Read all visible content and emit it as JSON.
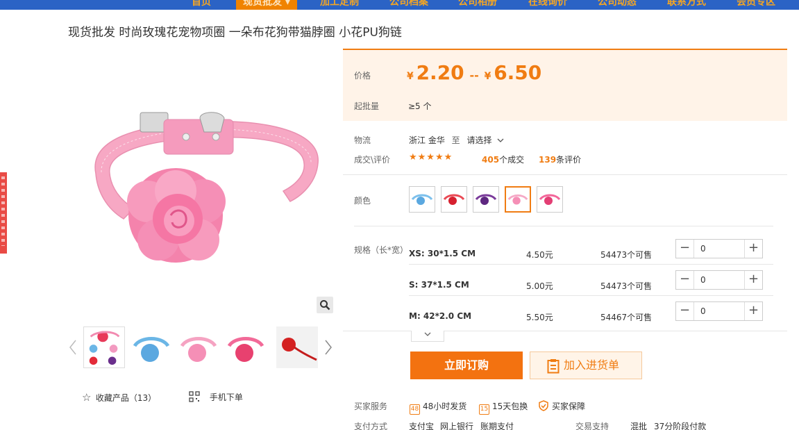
{
  "nav": {
    "items": [
      "首页",
      "现货批发 ▾",
      "加工定制",
      "公司档案",
      "公司相册",
      "在线询价",
      "公司动态",
      "联系方式",
      "会员专区"
    ],
    "active_index": 1
  },
  "product": {
    "title": "现货批发 时尚玫瑰花宠物项圈 一朵布花狗带猫脖圈 小花PU狗链"
  },
  "price": {
    "label": "价格",
    "currency": "¥",
    "min": "2.20",
    "separator": "--",
    "max": "6.50",
    "moq_label": "起批量",
    "moq_value": "≥5 个"
  },
  "logistics": {
    "label": "物流",
    "origin": "浙江 金华",
    "to": "至",
    "destination": "请选择",
    "chevron": "chevron-down-icon"
  },
  "rating": {
    "label": "成交\\评价",
    "stars": "★★★★★",
    "deals_count": "405",
    "deals_suffix": "个成交",
    "reviews_count": "139",
    "reviews_suffix": "条评价"
  },
  "color": {
    "label": "颜色",
    "swatches": [
      "blue",
      "red",
      "purple",
      "pink",
      "rose"
    ],
    "selected_index": 3
  },
  "spec": {
    "label": "规格（长*宽）",
    "rows": [
      {
        "name": "XS: 30*1.5 CM",
        "price": "4.50元",
        "available": "54473个可售",
        "qty": "0"
      },
      {
        "name": "S: 37*1.5 CM",
        "price": "5.00元",
        "available": "54473个可售",
        "qty": "0"
      },
      {
        "name": "M: 42*2.0 CM",
        "price": "5.50元",
        "available": "54467个可售",
        "qty": "0"
      }
    ],
    "minus": "−",
    "plus": "+"
  },
  "actions": {
    "order": "立即订购",
    "cart": "加入进货单"
  },
  "gallery": {
    "favorite": "收藏产品（13）",
    "mobile": "手机下单"
  },
  "services": {
    "label": "买家服务",
    "items": [
      {
        "icon": "48",
        "text": "48小时发货"
      },
      {
        "icon": "15",
        "text": "15天包换"
      },
      {
        "icon": "shield",
        "text": "买家保障"
      }
    ]
  },
  "payment": {
    "label": "支付方式",
    "methods": [
      "支付宝",
      "网上银行",
      "账期支付"
    ],
    "trade_label": "交易支持",
    "trade_values": [
      "混批",
      "37分阶段付款"
    ]
  },
  "colors": {
    "accent": "#f07c12",
    "nav_bg": "#2b63c5",
    "price_bg": "#fff3e8"
  }
}
